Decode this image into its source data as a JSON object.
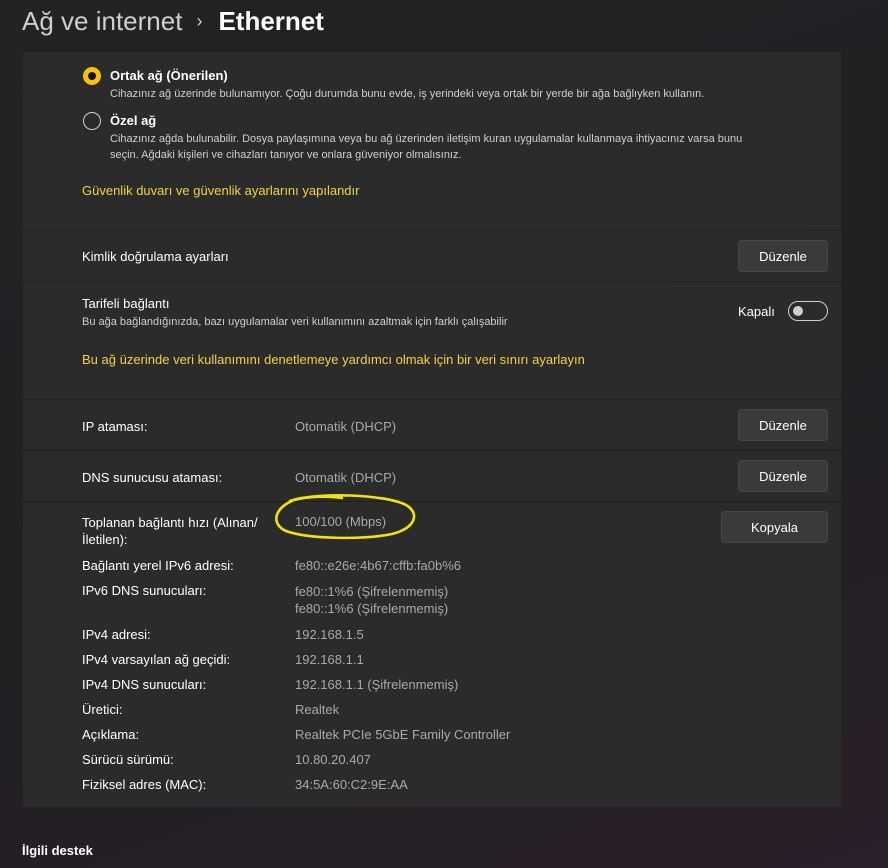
{
  "breadcrumb": {
    "parent": "Ağ ve internet",
    "separator": "›",
    "current": "Ethernet"
  },
  "network_profile": {
    "public": {
      "title": "Ortak ağ (Önerilen)",
      "description": "Cihazınız ağ üzerinde bulunamıyor. Çoğu durumda bunu evde, iş yerindeki veya ortak bir yerde bir ağa bağlıyken kullanın.",
      "selected": true
    },
    "private": {
      "title": "Özel ağ",
      "description_line1": "Cihazınız ağda bulunabilir. Dosya paylaşımına veya bu ağ üzerinden iletişim kuran uygulamalar kullanmaya ihtiyacınız varsa bunu",
      "description_line2": "seçin. Ağdaki kişileri ve cihazları tanıyor ve onlara güveniyor olmalısınız.",
      "selected": false
    },
    "firewall_link": "Güvenlik duvarı ve güvenlik ayarlarını yapılandır"
  },
  "authentication": {
    "label": "Kimlik doğrulama ayarları",
    "button": "Düzenle"
  },
  "metered": {
    "title": "Tarifeli bağlantı",
    "description": "Bu ağa bağlandığınızda, bazı uygulamalar veri kullanımını azaltmak için farklı çalışabilir",
    "toggle_label": "Kapalı",
    "toggle_on": false,
    "data_limit_link": "Bu ağ üzerinde veri kullanımını denetlemeye yardımcı olmak için bir veri sınırı ayarlayın"
  },
  "ip_assignment": {
    "label": "IP ataması:",
    "value": "Otomatik (DHCP)",
    "button": "Düzenle"
  },
  "dns_assignment": {
    "label": "DNS sunucusu ataması:",
    "value": "Otomatik (DHCP)",
    "button": "Düzenle"
  },
  "properties": {
    "copy_button": "Kopyala",
    "link_speed_label_line1": "Toplanan bağlantı hızı (Alınan/",
    "link_speed_label_line2": "İletilen):",
    "link_speed_value": "100/100 (Mbps)",
    "ipv6_local_label": "Bağlantı yerel IPv6 adresi:",
    "ipv6_local_value": "fe80::e26e:4b67:cffb:fa0b%6",
    "ipv6_dns_label": "IPv6 DNS sunucuları:",
    "ipv6_dns_value_1": "fe80::1%6 (Şifrelenmemiş)",
    "ipv6_dns_value_2": "fe80::1%6 (Şifrelenmemiş)",
    "ipv4_label": "IPv4 adresi:",
    "ipv4_value": "192.168.1.5",
    "gateway_label": "IPv4 varsayılan ağ geçidi:",
    "gateway_value": "192.168.1.1",
    "ipv4_dns_label": "IPv4 DNS sunucuları:",
    "ipv4_dns_value": "192.168.1.1 (Şifrelenmemiş)",
    "manufacturer_label": "Üretici:",
    "manufacturer_value": "Realtek",
    "description_label": "Açıklama:",
    "description_value": "Realtek PCIe 5GbE Family Controller",
    "driver_label": "Sürücü sürümü:",
    "driver_value": "10.80.20.407",
    "mac_label": "Fiziksel adres (MAC):",
    "mac_value": "34:5A:60:C2:9E:AA"
  },
  "related_support": {
    "title": "İlgili destek"
  },
  "colors": {
    "accent": "#f4c400",
    "link": "#f4d33a",
    "annotation": "#f2e600"
  }
}
